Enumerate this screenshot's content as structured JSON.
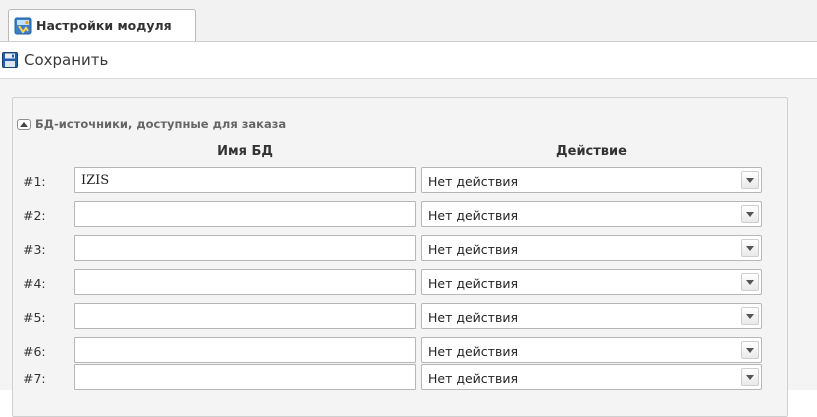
{
  "tabs": [
    {
      "label": "Настройки модуля",
      "active": true,
      "icon": "module-settings-icon"
    }
  ],
  "toolbar": {
    "save_label": "Сохранить",
    "save_icon": "floppy-disk-icon"
  },
  "section": {
    "title": "БД-источники, доступные для заказа",
    "expanded": true,
    "columns": {
      "db_name": "Имя БД",
      "action": "Действие"
    },
    "rows": [
      {
        "num": "#1:",
        "db_name": "IZIS",
        "action": "Нет действия"
      },
      {
        "num": "#2:",
        "db_name": "",
        "action": "Нет действия"
      },
      {
        "num": "#3:",
        "db_name": "",
        "action": "Нет действия"
      },
      {
        "num": "#4:",
        "db_name": "",
        "action": "Нет действия"
      },
      {
        "num": "#5:",
        "db_name": "",
        "action": "Нет действия"
      },
      {
        "num": "#6:",
        "db_name": "",
        "action": "Нет действия"
      },
      {
        "num": "#7:",
        "db_name": "",
        "action": "Нет действия"
      }
    ]
  },
  "colors": {
    "accent_blue": "#1f5fa8",
    "panel_bg": "#f4f4f4"
  }
}
